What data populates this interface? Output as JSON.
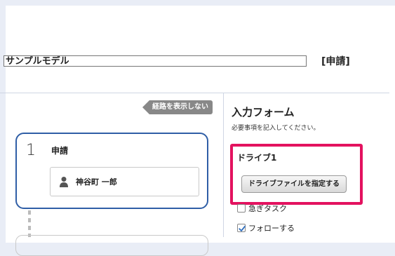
{
  "header": {
    "title": "サンプルモデル",
    "status": "[申請]"
  },
  "route": {
    "toggle_label": "経路を表示しない",
    "step": {
      "number": "1",
      "label": "申請",
      "assignee": "神谷町 一郎"
    }
  },
  "form": {
    "title": "入力フォーム",
    "subtitle": "必要事項を記入してください。",
    "drive": {
      "label": "ドライブ1",
      "button_label": "ドライブファイルを指定する"
    },
    "checkboxes": [
      {
        "label": "急ぎタスク",
        "checked": false
      },
      {
        "label": "フォローする",
        "checked": true
      }
    ],
    "colors": {
      "highlight": "#e3125f",
      "step_border": "#2f5ea6",
      "check_accent": "#2f6fbf"
    }
  }
}
